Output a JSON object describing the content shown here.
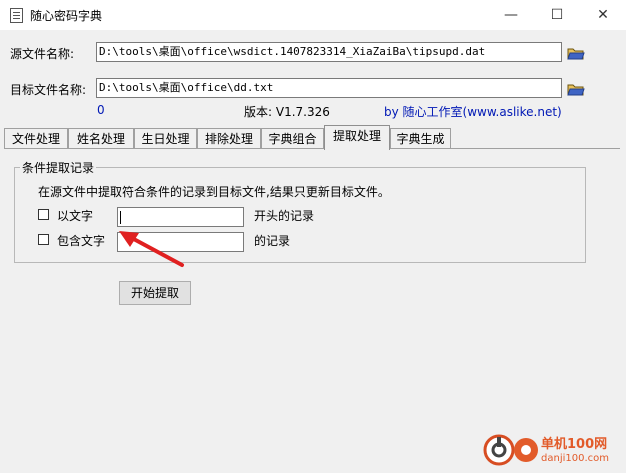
{
  "window": {
    "title": "随心密码字典",
    "icons": [
      "document-icon",
      "minimize-icon",
      "maximize-icon",
      "close-icon"
    ]
  },
  "source": {
    "label": "源文件名称:",
    "value": "D:\\tools\\桌面\\office\\wsdict.1407823314_XiaZaiBa\\tipsupd.dat"
  },
  "target": {
    "label": "目标文件名称:",
    "value": "D:\\tools\\桌面\\office\\dd.txt"
  },
  "status": {
    "count": "0",
    "version": "版本: V1.7.326",
    "author": "by 随心工作室(www.aslike.net)"
  },
  "tabs": [
    {
      "label": "文件处理"
    },
    {
      "label": "姓名处理"
    },
    {
      "label": "生日处理"
    },
    {
      "label": "排除处理"
    },
    {
      "label": "字典组合"
    },
    {
      "label": "提取处理",
      "active": true
    },
    {
      "label": "字典生成"
    }
  ],
  "group": {
    "title": "条件提取记录",
    "description": "在源文件中提取符合条件的记录到目标文件,结果只更新目标文件。",
    "option1": {
      "label": "以文字",
      "suffix": "开头的记录",
      "value": "",
      "checked": false
    },
    "option2": {
      "label": "包含文字",
      "suffix": "的记录",
      "value": "",
      "checked": false
    }
  },
  "action": {
    "label": "开始提取"
  },
  "watermark": {
    "text1": "单机100网",
    "text2": "danji100.com"
  },
  "colors": {
    "link": "#0018b5",
    "annotation_arrow": "#e02020",
    "watermark": "#e25b2a"
  }
}
